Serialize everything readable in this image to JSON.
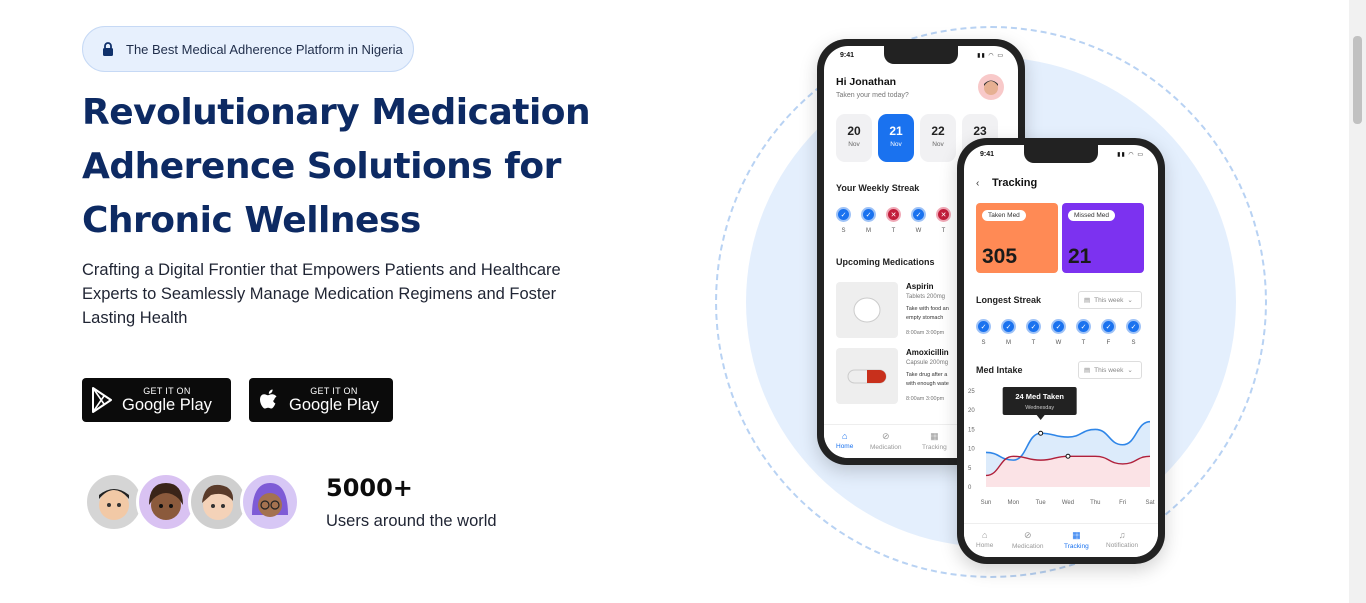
{
  "badge": {
    "icon": "lock-icon",
    "text": "The Best Medical Adherence Platform in Nigeria"
  },
  "hero": {
    "title": "Revolutionary Medication Adherence Solutions for Chronic Wellness",
    "subtitle": "Crafting a Digital Frontier that Empowers Patients and Healthcare Experts to Seamlessly Manage Medication Regimens and Foster Lasting Health"
  },
  "stores": [
    {
      "small": "GET IT ON",
      "large": "Google Play",
      "icon": "google-play-icon"
    },
    {
      "small": "GET IT ON",
      "large": "Google Play",
      "icon": "apple-icon"
    }
  ],
  "users": {
    "count": "5000+",
    "label": "Users around the world"
  },
  "phone_home": {
    "time": "9:41",
    "greeting": "Hi Jonathan",
    "question": "Taken your med today?",
    "days": [
      {
        "n": "20",
        "m": "Nov"
      },
      {
        "n": "21",
        "m": "Nov"
      },
      {
        "n": "22",
        "m": "Nov"
      },
      {
        "n": "23",
        "m": ""
      }
    ],
    "streak_title": "Your Weekly Streak",
    "streak": [
      {
        "d": "S",
        "ok": true
      },
      {
        "d": "M",
        "ok": true
      },
      {
        "d": "T",
        "ok": false
      },
      {
        "d": "W",
        "ok": true
      },
      {
        "d": "T",
        "ok": false
      }
    ],
    "upcoming_title": "Upcoming Medications",
    "meds": [
      {
        "name": "Aspirin",
        "info": "Tablets   200mg",
        "desc": "Take with food an\nempty stomach",
        "time": "8:00am   3:00pm"
      },
      {
        "name": "Amoxicillin",
        "info": "Capsule   200mg",
        "desc": "Take drug after a\nwith enough wate",
        "time": "8:00am   3:00pm"
      }
    ],
    "nav": [
      "Home",
      "Medication",
      "Tracking"
    ]
  },
  "phone_tracking": {
    "time": "9:41",
    "title": "Tracking",
    "taken_label": "Taken Med",
    "taken_value": "305",
    "missed_label": "Missed Med",
    "missed_value": "21",
    "streak_title": "Longest Streak",
    "period": "This week",
    "streak_days": [
      "S",
      "M",
      "T",
      "W",
      "T",
      "F",
      "S"
    ],
    "intake_title": "Med Intake",
    "intake_period": "This week",
    "nav": [
      "Home",
      "Medication",
      "Tracking",
      "Notification"
    ]
  },
  "chart_data": {
    "type": "line",
    "title": "",
    "categories": [
      "Sun",
      "Mon",
      "Tue",
      "Wed",
      "Thu",
      "Fri",
      "Sat"
    ],
    "ylim": [
      0,
      25
    ],
    "yticks": [
      "0",
      "5",
      "10",
      "15",
      "20",
      "25"
    ],
    "series": [
      {
        "values": [
          9,
          7,
          14,
          13,
          15,
          11,
          17
        ]
      },
      {
        "values": [
          3,
          8,
          7,
          8,
          8,
          6,
          8
        ]
      }
    ],
    "tooltip": {
      "title": "24 Med Taken",
      "sub": "Wednesday"
    },
    "colors": {
      "blue": "#2f86e8",
      "red": "#b0203b"
    }
  }
}
